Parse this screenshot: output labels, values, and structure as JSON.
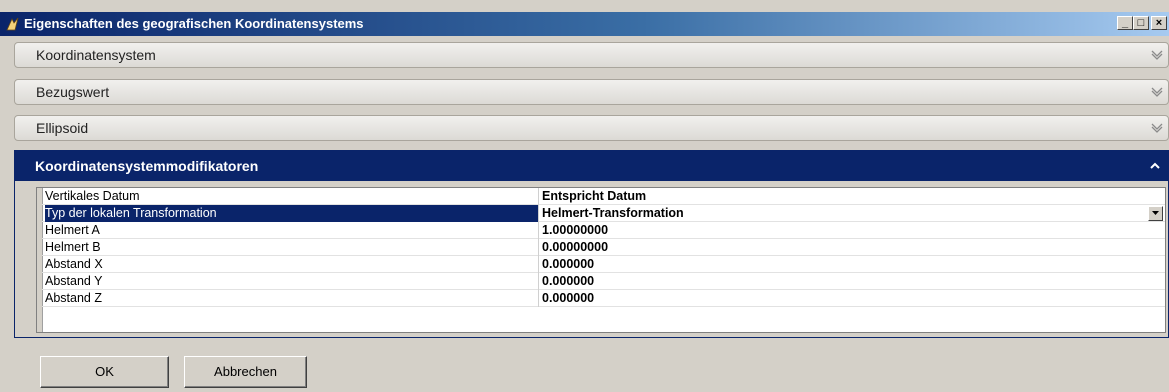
{
  "window": {
    "title": "Eigenschaften des geografischen Koordinatensystems",
    "minimize_label": "_",
    "maximize_label": "□",
    "close_label": "×"
  },
  "sections": [
    {
      "label": "Koordinatensystem",
      "expanded": false
    },
    {
      "label": "Bezugswert",
      "expanded": false
    },
    {
      "label": "Ellipsoid",
      "expanded": false
    }
  ],
  "active_section": {
    "label": "Koordinatensystemmodifikatoren",
    "expanded": true
  },
  "properties": [
    {
      "name": "Vertikales Datum",
      "value": "Entspricht Datum"
    },
    {
      "name": "Typ der lokalen Transformation",
      "value": "Helmert-Transformation",
      "selected": true,
      "has_dropdown": true
    },
    {
      "name": "Helmert A",
      "value": "1.00000000"
    },
    {
      "name": "Helmert B",
      "value": "0.00000000"
    },
    {
      "name": "Abstand X",
      "value": "0.000000"
    },
    {
      "name": "Abstand Y",
      "value": "0.000000"
    },
    {
      "name": "Abstand Z",
      "value": "0.000000"
    }
  ],
  "buttons": {
    "ok": "OK",
    "cancel": "Abbrechen"
  },
  "colors": {
    "selection": "#0a246a",
    "header": "#0a246a"
  }
}
